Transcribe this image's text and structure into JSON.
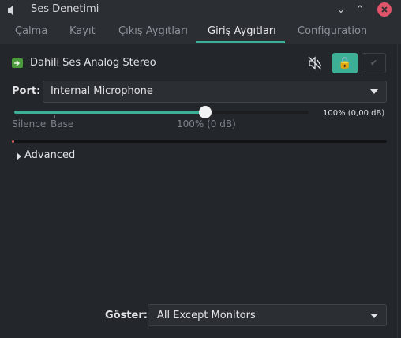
{
  "window": {
    "title": "Ses Denetimi",
    "controls": {
      "minimize": "⌄",
      "maximize": "⌃",
      "close": "×"
    }
  },
  "tabs": [
    {
      "label": "Çalma",
      "active": false
    },
    {
      "label": "Kayıt",
      "active": false
    },
    {
      "label": "Çıkış Aygıtları",
      "active": false
    },
    {
      "label": "Giriş Aygıtları",
      "active": true
    },
    {
      "label": "Configuration",
      "active": false
    }
  ],
  "device": {
    "name": "Dahili Ses Analog Stereo",
    "mute_icon": "speaker-muted-icon",
    "lock_icon": "lock-icon",
    "default_icon": "check-icon"
  },
  "port": {
    "label": "Port:",
    "value": "Internal Microphone"
  },
  "volume": {
    "value_text": "100% (0,00 dB)",
    "fraction": 0.65,
    "marks": {
      "silence": "Silence",
      "base": "Base",
      "hundred": "100% (0 dB)"
    }
  },
  "level_meter": {
    "fraction": 0.006
  },
  "advanced": {
    "label": "Advanced"
  },
  "footer": {
    "show_label": "Göster:",
    "show_value": "All Except Monitors"
  },
  "colors": {
    "accent": "#3daf97",
    "close": "#e0556a",
    "meter": "#e05a5a"
  }
}
